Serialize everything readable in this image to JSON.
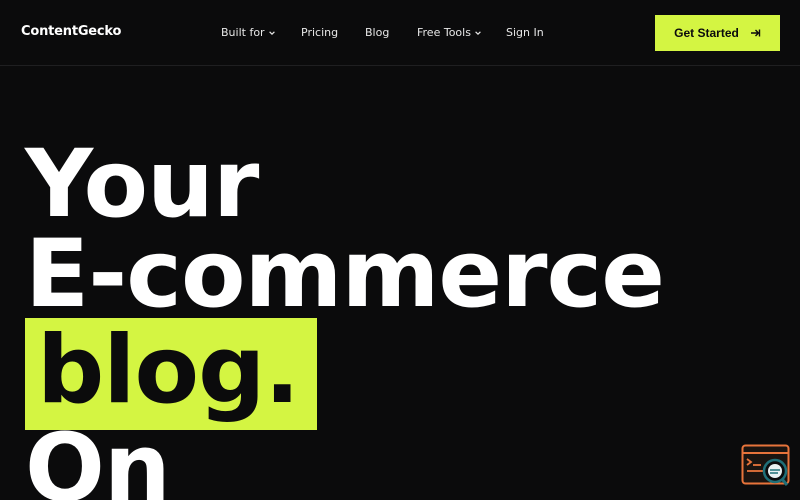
{
  "header": {
    "logo": "ContentGecko",
    "nav": [
      {
        "label": "Built for",
        "has_dropdown": true
      },
      {
        "label": "Pricing",
        "has_dropdown": false
      },
      {
        "label": "Blog",
        "has_dropdown": false
      },
      {
        "label": "Free Tools",
        "has_dropdown": true
      },
      {
        "label": "Sign In",
        "has_dropdown": false
      }
    ],
    "cta_label": "Get Started",
    "cta_icon": "arrow-right-icon"
  },
  "hero": {
    "line1": "Your",
    "line2": "E-commerce",
    "line3_highlight": "blog.",
    "line4": "On"
  },
  "widget": {
    "icon": "chat-widget-icon"
  },
  "colors": {
    "background": "#0b0b0c",
    "accent": "#d4f542",
    "text": "#ffffff",
    "widget_orange": "#e8743b",
    "widget_teal": "#1f6f78"
  }
}
